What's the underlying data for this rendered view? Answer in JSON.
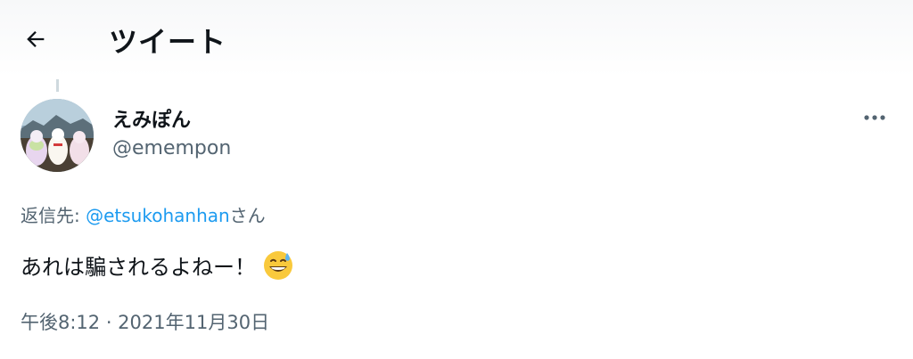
{
  "header": {
    "back_icon": "arrow-left-icon",
    "title": "ツイート"
  },
  "tweet": {
    "author": {
      "display_name": "えみぽん",
      "handle": "@emempon",
      "avatar": "avatar-photo-alpaca-plushies"
    },
    "more_icon": "more-horizontal-icon",
    "reply": {
      "prefix": "返信先: ",
      "mention": "@etsukohanhan",
      "suffix": "さん"
    },
    "text": "あれは騙されるよねー！",
    "emoji": "grinning-face-with-sweat-emoji",
    "timestamp": "午後8:12 · 2021年11月30日"
  },
  "colors": {
    "primary_text": "#0f1419",
    "secondary_text": "#536471",
    "link": "#1d9bf0"
  }
}
